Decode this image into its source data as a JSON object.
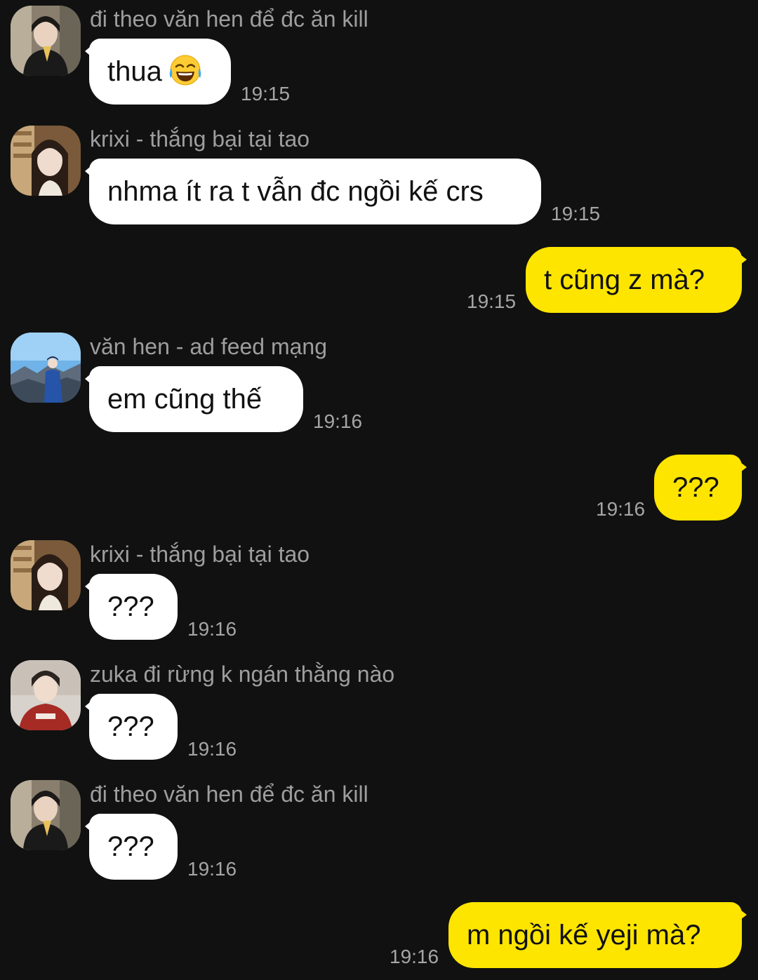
{
  "messages": [
    {
      "sender": "đi theo văn hen để đc ăn kill",
      "text": "thua",
      "emoji": "face-with-tears-of-joy-icon",
      "time": "19:15",
      "direction": "in"
    },
    {
      "sender": "krixi - thắng bại tại tao",
      "text": "nhma ít ra t vẫn đc ngồi kế crs",
      "time": "19:15",
      "direction": "in"
    },
    {
      "text": "t cũng z mà?",
      "time": "19:15",
      "direction": "out"
    },
    {
      "sender": "văn hen - ad feed mạng",
      "text": "em cũng thế",
      "time": "19:16",
      "direction": "in"
    },
    {
      "text": "???",
      "time": "19:16",
      "direction": "out"
    },
    {
      "sender": "krixi - thắng bại tại tao",
      "text": "???",
      "time": "19:16",
      "direction": "in"
    },
    {
      "sender": "zuka đi rừng k ngán thằng nào",
      "text": "???",
      "time": "19:16",
      "direction": "in"
    },
    {
      "sender": "đi theo văn hen để đc ăn kill",
      "text": "???",
      "time": "19:16",
      "direction": "in"
    },
    {
      "text": "m ngồi kế yeji mà?",
      "time": "19:16",
      "direction": "out"
    }
  ],
  "colors": {
    "background": "#111111",
    "incoming_bubble": "#ffffff",
    "outgoing_bubble": "#fee500",
    "sender_name": "#9e9e9e",
    "timestamp": "#a5a5a5"
  }
}
